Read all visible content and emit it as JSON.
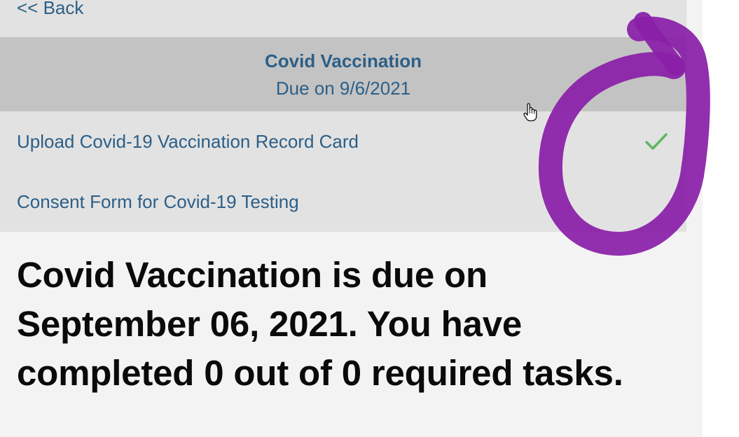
{
  "nav": {
    "back_label": "<< Back"
  },
  "header": {
    "title": "Covid Vaccination",
    "due": "Due on 9/6/2021"
  },
  "tasks": [
    {
      "label": "Upload Covid-19 Vaccination Record Card",
      "completed": true
    },
    {
      "label": "Consent Form for Covid-19 Testing",
      "completed": false
    }
  ],
  "message": "Covid Vaccination is due on September 06, 2021. You have completed 0 out of 0 required tasks.",
  "colors": {
    "link_text": "#2c5f87",
    "header_bg": "#c3c3c3",
    "row_bg": "#e2e2e2",
    "check_green": "#5fb85f",
    "marker_purple": "#8a1fa8"
  },
  "icons": {
    "check": "check-icon",
    "cursor": "hand-pointer-icon"
  }
}
